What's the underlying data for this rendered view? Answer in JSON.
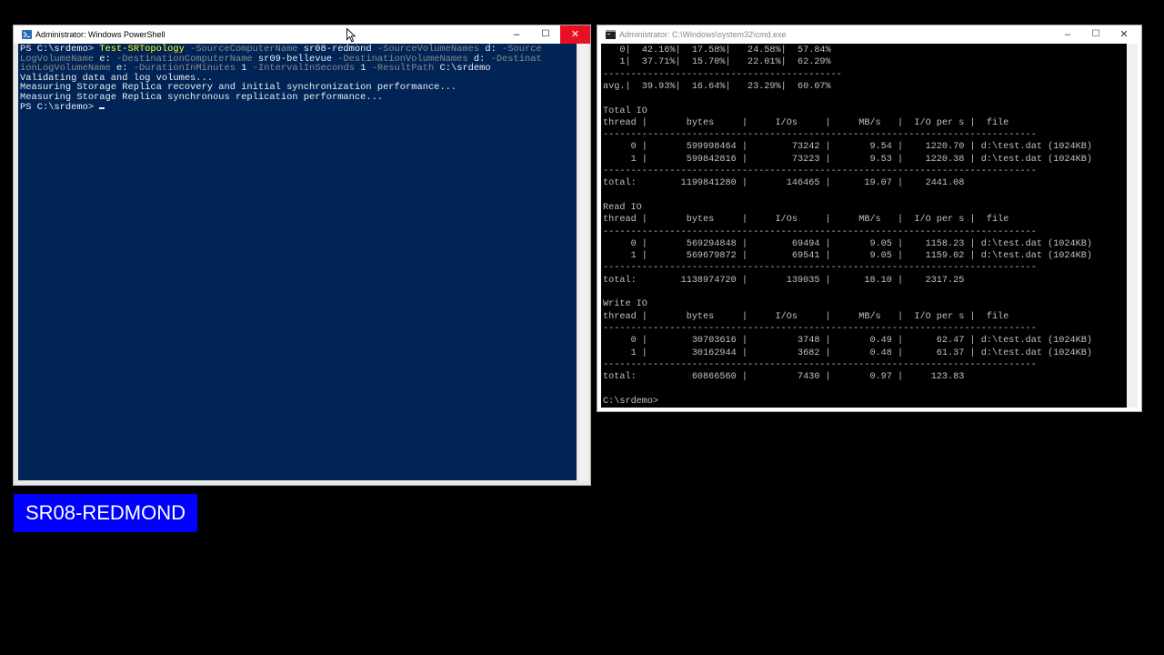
{
  "powershell": {
    "title": "Administrator: Windows PowerShell",
    "icon": "powershell-icon",
    "lines": [
      [
        {
          "t": "PS C:\\srdemo> ",
          "c": "w"
        },
        {
          "t": "Test-SRTopology",
          "c": "y"
        },
        {
          "t": " -SourceComputerName ",
          "c": "g"
        },
        {
          "t": "sr08-redmond",
          "c": "w"
        },
        {
          "t": " -SourceVolumeNames ",
          "c": "g"
        },
        {
          "t": "d:",
          "c": "w"
        },
        {
          "t": " -Source",
          "c": "g"
        }
      ],
      [
        {
          "t": "LogVolumeName ",
          "c": "g"
        },
        {
          "t": "e:",
          "c": "w"
        },
        {
          "t": " -DestinationComputerName ",
          "c": "g"
        },
        {
          "t": "sr09-bellevue",
          "c": "w"
        },
        {
          "t": " -DestinationVolumeNames ",
          "c": "g"
        },
        {
          "t": "d:",
          "c": "w"
        },
        {
          "t": " -Destinat",
          "c": "g"
        }
      ],
      [
        {
          "t": "ionLogVolumeName ",
          "c": "g"
        },
        {
          "t": "e:",
          "c": "w"
        },
        {
          "t": " -DurationInMinutes ",
          "c": "g"
        },
        {
          "t": "1",
          "c": "w"
        },
        {
          "t": " -IntervalInSeconds ",
          "c": "g"
        },
        {
          "t": "1",
          "c": "w"
        },
        {
          "t": " -ResultPath ",
          "c": "g"
        },
        {
          "t": "C:\\srdemo",
          "c": "w"
        }
      ],
      [
        {
          "t": "Validating data and log volumes...",
          "c": "w"
        }
      ],
      [
        {
          "t": "Measuring Storage Replica recovery and initial synchronization performance...",
          "c": "w"
        }
      ],
      [
        {
          "t": "Measuring Storage Replica synchronous replication performance...",
          "c": "w"
        }
      ],
      [
        {
          "t": "PS C:\\srdemo> ",
          "c": "w"
        }
      ]
    ]
  },
  "cmd": {
    "title": "Administrator: C:\\Windows\\system32\\cmd.exe",
    "icon": "cmd-icon",
    "lines": [
      "   0|  42.16%|  17.58%|   24.58%|  57.84%",
      "   1|  37.71%|  15.70%|   22.01%|  62.29%",
      "-------------------------------------------",
      "avg.|  39.93%|  16.64%|   23.29%|  60.07%",
      "",
      "Total IO",
      "thread |       bytes     |     I/Os     |     MB/s   |  I/O per s |  file",
      "------------------------------------------------------------------------------",
      "     0 |       599998464 |        73242 |       9.54 |    1220.70 | d:\\test.dat (1024KB)",
      "     1 |       599842816 |        73223 |       9.53 |    1220.38 | d:\\test.dat (1024KB)",
      "------------------------------------------------------------------------------",
      "total:        1199841280 |       146465 |      19.07 |    2441.08",
      "",
      "Read IO",
      "thread |       bytes     |     I/Os     |     MB/s   |  I/O per s |  file",
      "------------------------------------------------------------------------------",
      "     0 |       569294848 |        69494 |       9.05 |    1158.23 | d:\\test.dat (1024KB)",
      "     1 |       569679872 |        69541 |       9.05 |    1159.02 | d:\\test.dat (1024KB)",
      "------------------------------------------------------------------------------",
      "total:        1138974720 |       139035 |      18.10 |    2317.25",
      "",
      "Write IO",
      "thread |       bytes     |     I/Os     |     MB/s   |  I/O per s |  file",
      "------------------------------------------------------------------------------",
      "     0 |        30703616 |         3748 |       0.49 |      62.47 | d:\\test.dat (1024KB)",
      "     1 |        30162944 |         3682 |       0.48 |      61.37 | d:\\test.dat (1024KB)",
      "------------------------------------------------------------------------------",
      "total:          60866560 |         7430 |       0.97 |     123.83",
      "",
      "C:\\srdemo>"
    ]
  },
  "window_controls": {
    "minimize": "–",
    "maximize": "☐",
    "close": "✕"
  },
  "label": {
    "text": "SR08-REDMOND"
  },
  "colors": {
    "powershell_bg": "#012456",
    "ps_yellow": "#ffff00",
    "ps_gray": "#8a8a8a",
    "ps_white": "#eeedf0",
    "label_bg": "#0000ff",
    "close_red": "#e81123"
  }
}
